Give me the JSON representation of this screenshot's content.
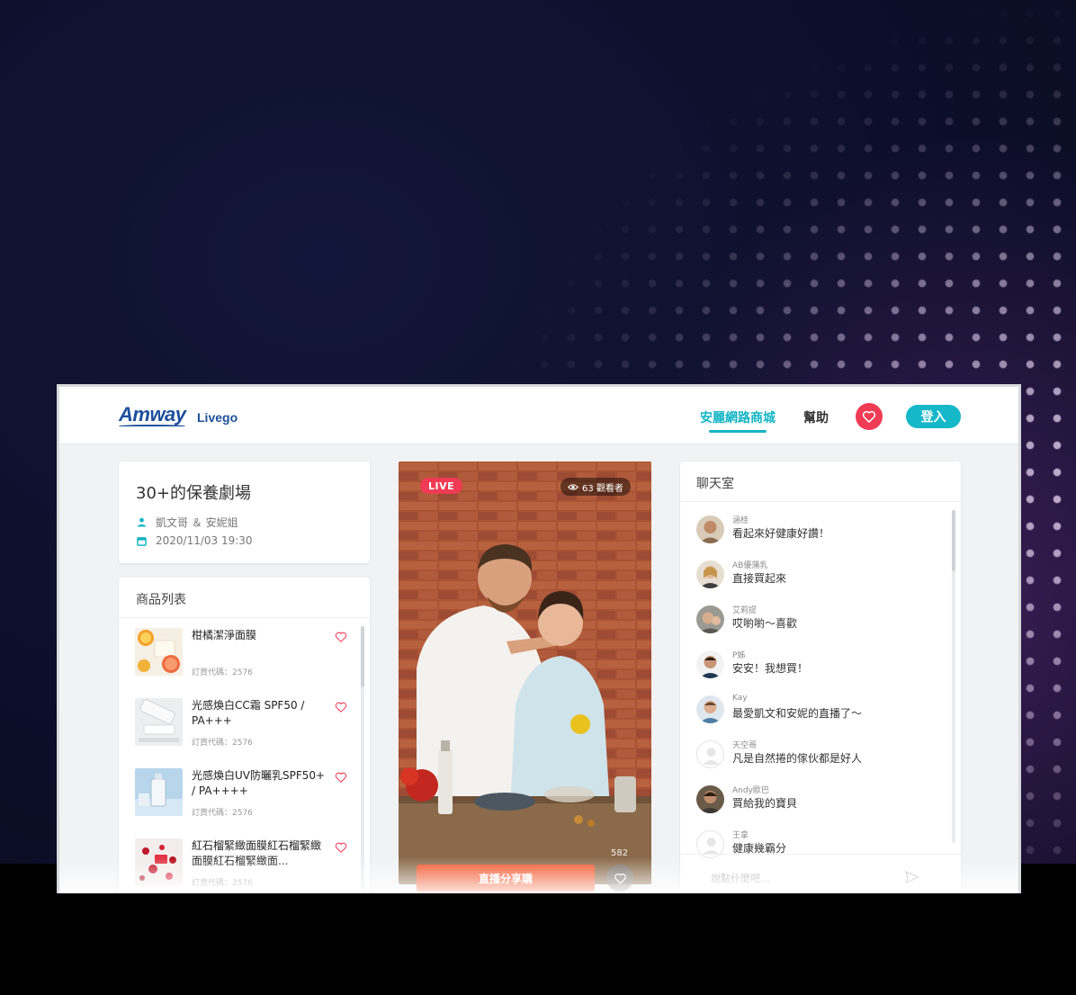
{
  "header": {
    "brand": "Amway",
    "sub_brand": "Livego",
    "nav_shop": "安麗網路商城",
    "nav_help": "幫助",
    "login": "登入"
  },
  "event": {
    "title": "30+的保養劇場",
    "hosts": "凱文哥 ＆ 安妮姐",
    "datetime": "2020/11/03 19:30"
  },
  "products": {
    "heading": "商品列表",
    "items": [
      {
        "name": "柑橘潔淨面膜",
        "code": "訂貨代碼：2576"
      },
      {
        "name": "光感煥白CC霜 SPF50 / PA+++",
        "code": "訂貨代碼：2576"
      },
      {
        "name": "光感煥白UV防曬乳SPF50+ / PA++++",
        "code": "訂貨代碼：2576"
      },
      {
        "name": "紅石榴緊緻面膜紅石榴緊緻面膜紅石榴緊緻面...",
        "code": "訂貨代碼：2576"
      }
    ]
  },
  "video": {
    "live_label": "LIVE",
    "viewers": "63 觀看者",
    "likes": "582",
    "share_buy": "直播分享購"
  },
  "chat": {
    "heading": "聊天室",
    "messages": [
      {
        "user": "涵桂",
        "text": "看起來好健康好讚！"
      },
      {
        "user": "AB優蒲乳",
        "text": "直接買起來"
      },
      {
        "user": "艾莉提",
        "text": "哎喲喲～喜歡"
      },
      {
        "user": "P姊",
        "text": "安安！我想買！"
      },
      {
        "user": "Kay",
        "text": "最愛凱文和安妮的直播了～"
      },
      {
        "user": "天空哥",
        "text": "凡是自然捲的傢伙都是好人"
      },
      {
        "user": "Andy歐巴",
        "text": "買給我的寶貝"
      },
      {
        "user": "王拿",
        "text": "健康幾霸分"
      }
    ],
    "input_placeholder": "說點什麼吧…"
  },
  "colors": {
    "accent": "#13b5c4",
    "live_red": "#ef3b55",
    "share_orange": "#f2552b",
    "brand_blue": "#1d4f9c"
  }
}
